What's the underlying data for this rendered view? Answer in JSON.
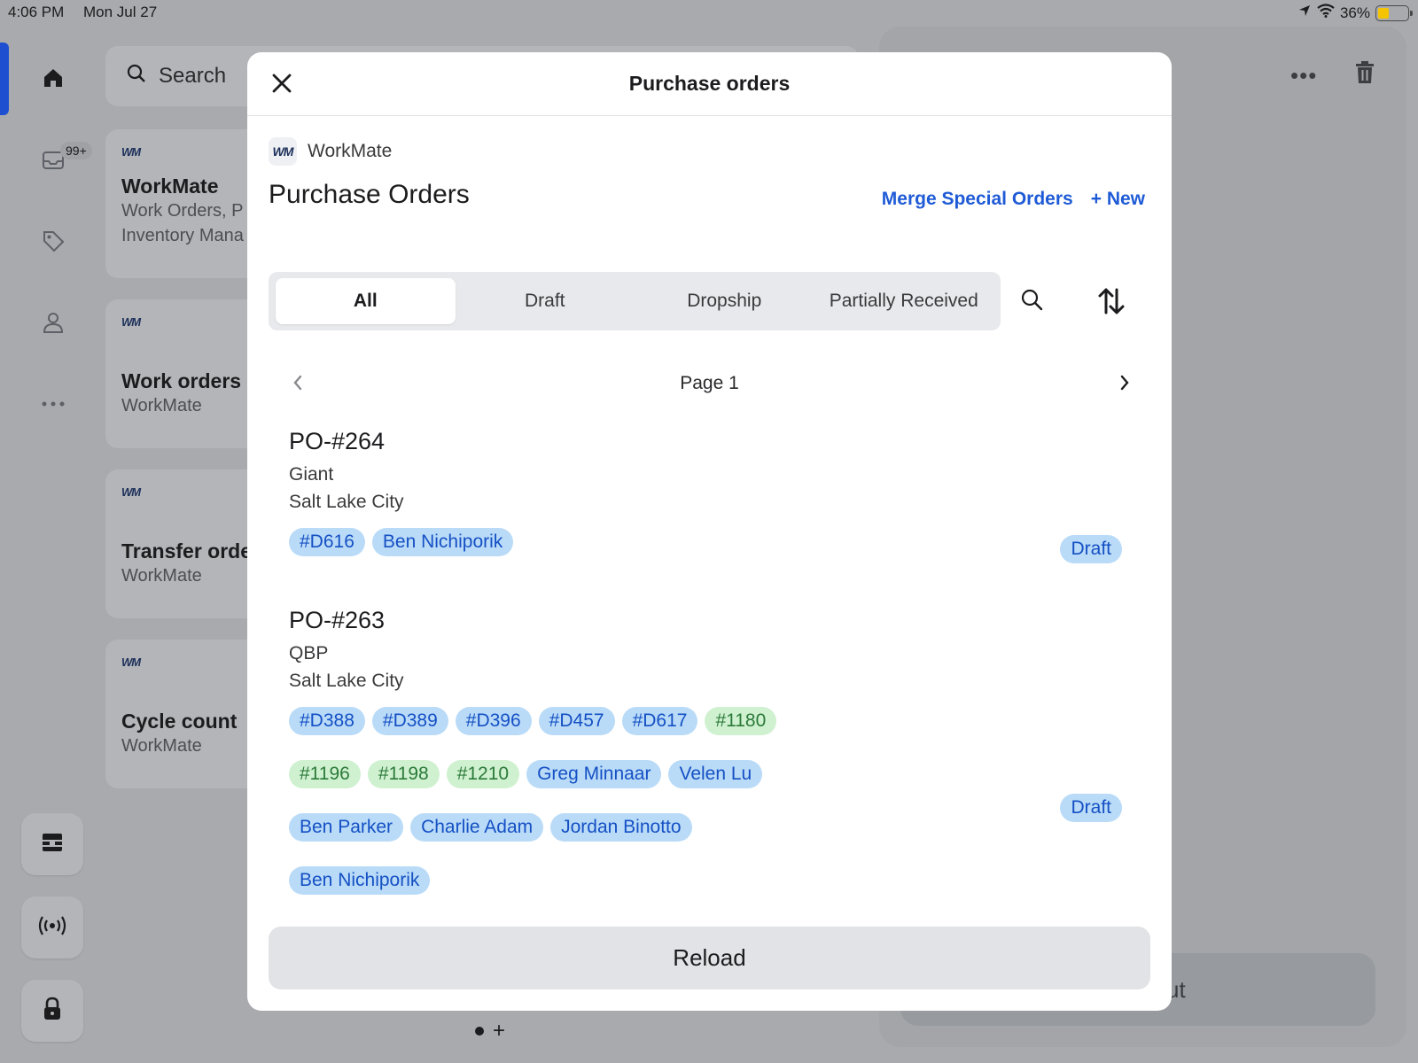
{
  "status_bar": {
    "time": "4:06 PM",
    "date": "Mon Jul 27",
    "battery": "36%",
    "battery_level": 0.36
  },
  "rail": {
    "badge": "99+"
  },
  "background": {
    "search_placeholder": "Search",
    "cards": [
      {
        "logo": "WM",
        "title": "WorkMate",
        "sub1": "Work Orders, P",
        "sub2": "Inventory Mana"
      },
      {
        "logo": "WM",
        "title": "Work orders",
        "sub1": "WorkMate",
        "sub2": ""
      },
      {
        "logo": "WM",
        "title": "Transfer orde",
        "sub1": "WorkMate",
        "sub2": ""
      },
      {
        "logo": "WM",
        "title": "Cycle count",
        "sub1": "WorkMate",
        "sub2": ""
      }
    ],
    "right_button_fragment": "ut",
    "more": "•••",
    "page_add": "+"
  },
  "modal": {
    "title": "Purchase orders",
    "app_logo": "WM",
    "app_name": "WorkMate",
    "heading": "Purchase Orders",
    "actions": {
      "merge": "Merge Special Orders",
      "new": "+ New"
    },
    "tabs": [
      "All",
      "Draft",
      "Dropship",
      "Partially Received"
    ],
    "active_tab": "All",
    "pager": {
      "label": "Page 1"
    },
    "orders": [
      {
        "id": "PO-#264",
        "vendor": "Giant",
        "location": "Salt Lake City",
        "status": "Draft",
        "chips": [
          {
            "text": "#D616",
            "color": "blue"
          },
          {
            "text": "Ben Nichiporik",
            "color": "blue"
          }
        ]
      },
      {
        "id": "PO-#263",
        "vendor": "QBP",
        "location": "Salt Lake City",
        "status": "Draft",
        "chips": [
          {
            "text": "#D388",
            "color": "blue"
          },
          {
            "text": "#D389",
            "color": "blue"
          },
          {
            "text": "#D396",
            "color": "blue"
          },
          {
            "text": "#D457",
            "color": "blue"
          },
          {
            "text": "#D617",
            "color": "blue"
          },
          {
            "text": "#1180",
            "color": "green"
          },
          {
            "text": "#1196",
            "color": "green"
          },
          {
            "text": "#1198",
            "color": "green"
          },
          {
            "text": "#1210",
            "color": "green"
          },
          {
            "text": "Greg Minnaar",
            "color": "blue"
          },
          {
            "text": "Velen Lu",
            "color": "blue"
          },
          {
            "text": "Ben Parker",
            "color": "blue"
          },
          {
            "text": "Charlie Adam",
            "color": "blue"
          },
          {
            "text": "Jordan Binotto",
            "color": "blue"
          },
          {
            "text": "Ben Nichiporik",
            "color": "blue"
          }
        ]
      }
    ],
    "reload_label": "Reload"
  },
  "colors": {
    "accent": "#1f5bd6",
    "chip_blue": "#b9dbf8",
    "chip_green": "#cff1d0",
    "rail_accent": "#1d4fd0"
  }
}
